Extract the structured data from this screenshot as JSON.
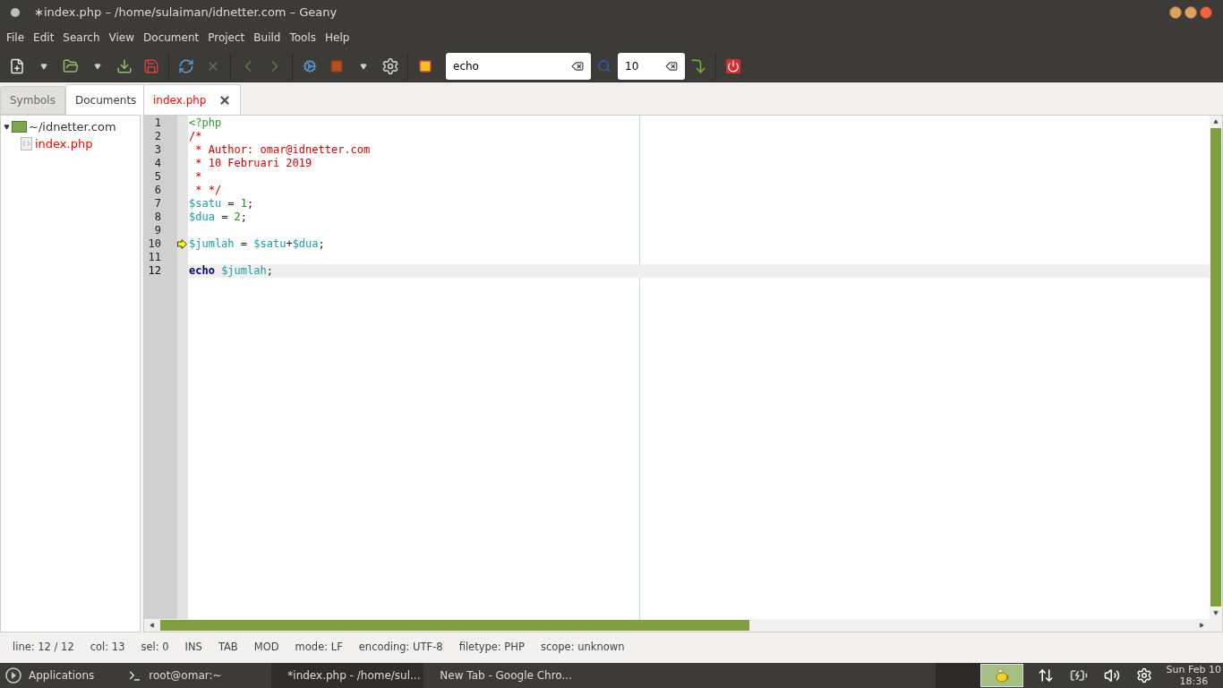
{
  "window": {
    "title": "∗index.php – ∕home∕sulaiman∕idnetter.com – Geany"
  },
  "menu": [
    "File",
    "Edit",
    "Search",
    "View",
    "Document",
    "Project",
    "Build",
    "Tools",
    "Help"
  ],
  "toolbar": {
    "search_value": "echo",
    "goto_value": "10"
  },
  "sidebar": {
    "tabs": [
      {
        "label": "Symbols",
        "selected": false
      },
      {
        "label": "Documents",
        "selected": true
      }
    ],
    "tree": [
      {
        "label": "~/idnetter.com",
        "expanded": true,
        "children": [
          {
            "label": "index.php",
            "modified": true
          }
        ]
      }
    ]
  },
  "documents": [
    {
      "label": "index.php",
      "modified": true,
      "selected": true
    }
  ],
  "editor": {
    "lines": [
      {
        "number": "1",
        "marker": false,
        "current": false,
        "tokens": [
          {
            "kind": "tag",
            "text": "<?php"
          }
        ]
      },
      {
        "number": "2",
        "marker": false,
        "current": false,
        "tokens": [
          {
            "kind": "comment",
            "text": "/*"
          }
        ]
      },
      {
        "number": "3",
        "marker": false,
        "current": false,
        "tokens": [
          {
            "kind": "comment",
            "text": " * Author: omar@idnetter.com"
          }
        ]
      },
      {
        "number": "4",
        "marker": false,
        "current": false,
        "tokens": [
          {
            "kind": "comment",
            "text": " * 10 Februari 2019"
          }
        ]
      },
      {
        "number": "5",
        "marker": false,
        "current": false,
        "tokens": [
          {
            "kind": "comment",
            "text": " *"
          }
        ]
      },
      {
        "number": "6",
        "marker": false,
        "current": false,
        "tokens": [
          {
            "kind": "comment",
            "text": " * */"
          }
        ]
      },
      {
        "number": "7",
        "marker": false,
        "current": false,
        "tokens": [
          {
            "kind": "var",
            "text": "$satu"
          },
          {
            "kind": "op",
            "text": " = "
          },
          {
            "kind": "num",
            "text": "1"
          },
          {
            "kind": "op",
            "text": ";"
          }
        ]
      },
      {
        "number": "8",
        "marker": false,
        "current": false,
        "tokens": [
          {
            "kind": "var",
            "text": "$dua"
          },
          {
            "kind": "op",
            "text": " = "
          },
          {
            "kind": "num",
            "text": "2"
          },
          {
            "kind": "op",
            "text": ";"
          }
        ]
      },
      {
        "number": "9",
        "marker": false,
        "current": false
      },
      {
        "number": "10",
        "marker": true,
        "current": false,
        "tokens": [
          {
            "kind": "var",
            "text": "$jumlah"
          },
          {
            "kind": "op",
            "text": " = "
          },
          {
            "kind": "var",
            "text": "$satu"
          },
          {
            "kind": "op",
            "text": "+"
          },
          {
            "kind": "var",
            "text": "$dua"
          },
          {
            "kind": "op",
            "text": ";"
          }
        ]
      },
      {
        "number": "11",
        "marker": false,
        "current": false
      },
      {
        "number": "12",
        "marker": false,
        "current": true,
        "tokens": [
          {
            "kind": "keyword",
            "text": "echo"
          },
          {
            "kind": "var",
            "text": " $jumlah"
          },
          {
            "kind": "op",
            "text": ";"
          }
        ]
      }
    ]
  },
  "status_bar": [
    "line: 12 / 12",
    "col: 13",
    "sel: 0",
    "INS",
    "TAB",
    "MOD",
    "mode: LF",
    "encoding: UTF-8",
    "filetype: PHP",
    "scope: unknown"
  ],
  "taskbar": {
    "start": "Applications",
    "tasks": [
      {
        "label": "root@omar:~",
        "kind": "terminal",
        "selected": false
      },
      {
        "label": "*index.php - /home/sul...",
        "kind": "geany",
        "selected": true
      },
      {
        "label": "New Tab - Google Chro...",
        "kind": "browser",
        "selected": false
      }
    ],
    "clock": [
      "Sun Feb 10",
      "18:36"
    ]
  }
}
